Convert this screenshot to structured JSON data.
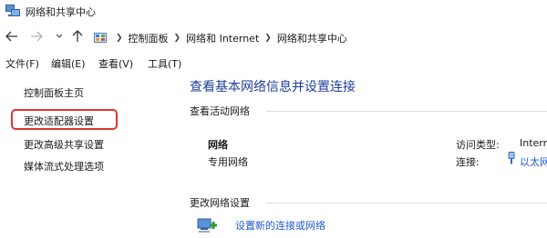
{
  "window": {
    "title": "网络和共享中心"
  },
  "address": {
    "crumbs": [
      "控制面板",
      "网络和 Internet",
      "网络和共享中心"
    ]
  },
  "menu": {
    "items": [
      "文件(F)",
      "编辑(E)",
      "查看(V)",
      "工具(T)"
    ]
  },
  "sidebar": {
    "items": [
      "控制面板主页",
      "更改适配器设置",
      "更改高级共享设置",
      "媒体流式处理选项"
    ],
    "highlighted": "更改适配器设置",
    "highlight_color": "#e0342f"
  },
  "main": {
    "title": "查看基本网络信息并设置连接",
    "active_networks_heading": "查看活动网络",
    "network": {
      "name": "网络",
      "type": "专用网络",
      "access_type_label": "访问类型:",
      "access_type_value": "Intern",
      "connection_label": "连接:",
      "connection_value": "以太网"
    },
    "change_settings_heading": "更改网络设置",
    "setup_link": "设置新的连接或网络"
  },
  "colors": {
    "title_blue": "#1e3f9c",
    "link_blue": "#1e5bd1"
  },
  "icons": [
    "network-center-icon",
    "back-arrow-icon",
    "forward-arrow-icon",
    "recent-dropdown-icon",
    "up-arrow-icon",
    "control-panel-icon",
    "ethernet-icon",
    "new-connection-icon"
  ]
}
